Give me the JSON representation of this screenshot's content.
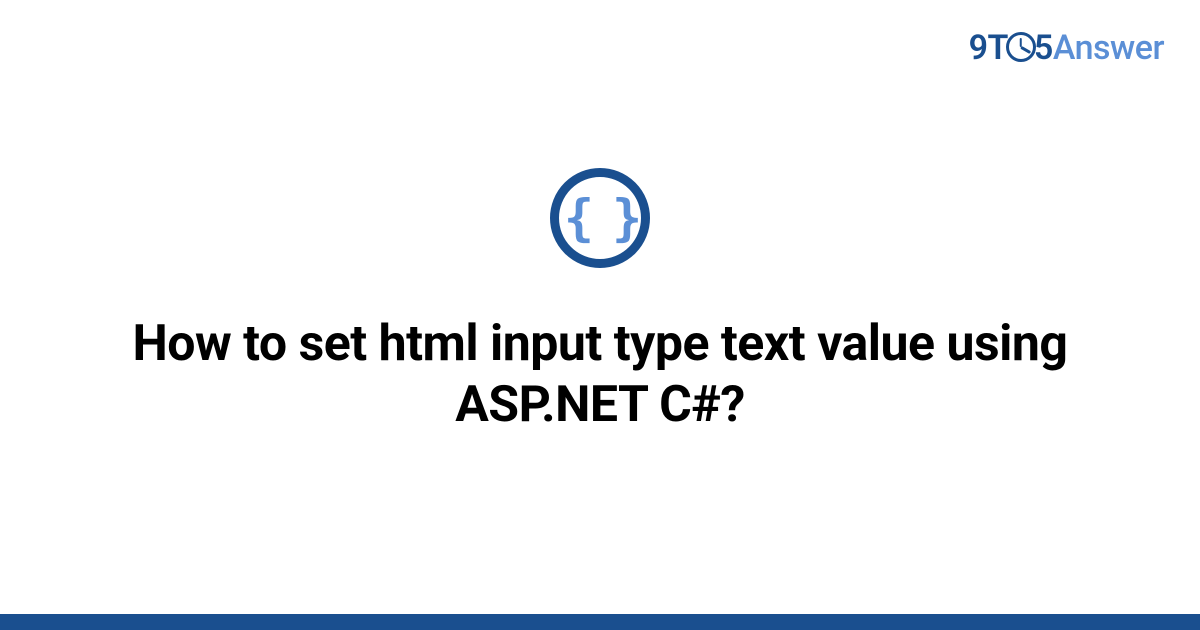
{
  "logo": {
    "part1": "9T",
    "part2": "5",
    "part3": "Answer"
  },
  "icon": {
    "name": "code-braces",
    "glyph": "{ }"
  },
  "title": "How to set html input type text value using ASP.NET C#?",
  "colors": {
    "accent_dark": "#1a4f8f",
    "accent_light": "#5b8fd6"
  }
}
